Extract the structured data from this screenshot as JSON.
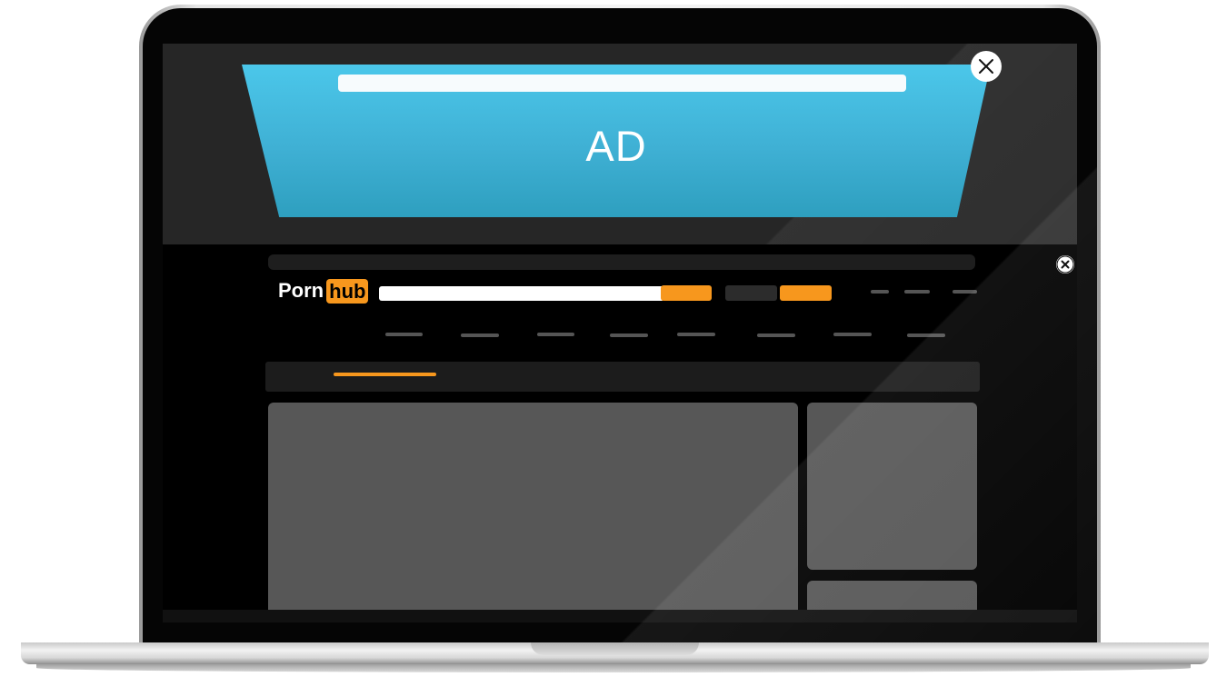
{
  "ad": {
    "label": "AD"
  },
  "site": {
    "logo_left": "Porn",
    "logo_right": "hub"
  },
  "icons": {
    "ad_close": "close-icon",
    "page_close": "close-icon"
  },
  "colors": {
    "accent": "#f7971d",
    "ad_blue": "#45bde3",
    "placeholder_gray": "#575757",
    "background": "#000000"
  }
}
